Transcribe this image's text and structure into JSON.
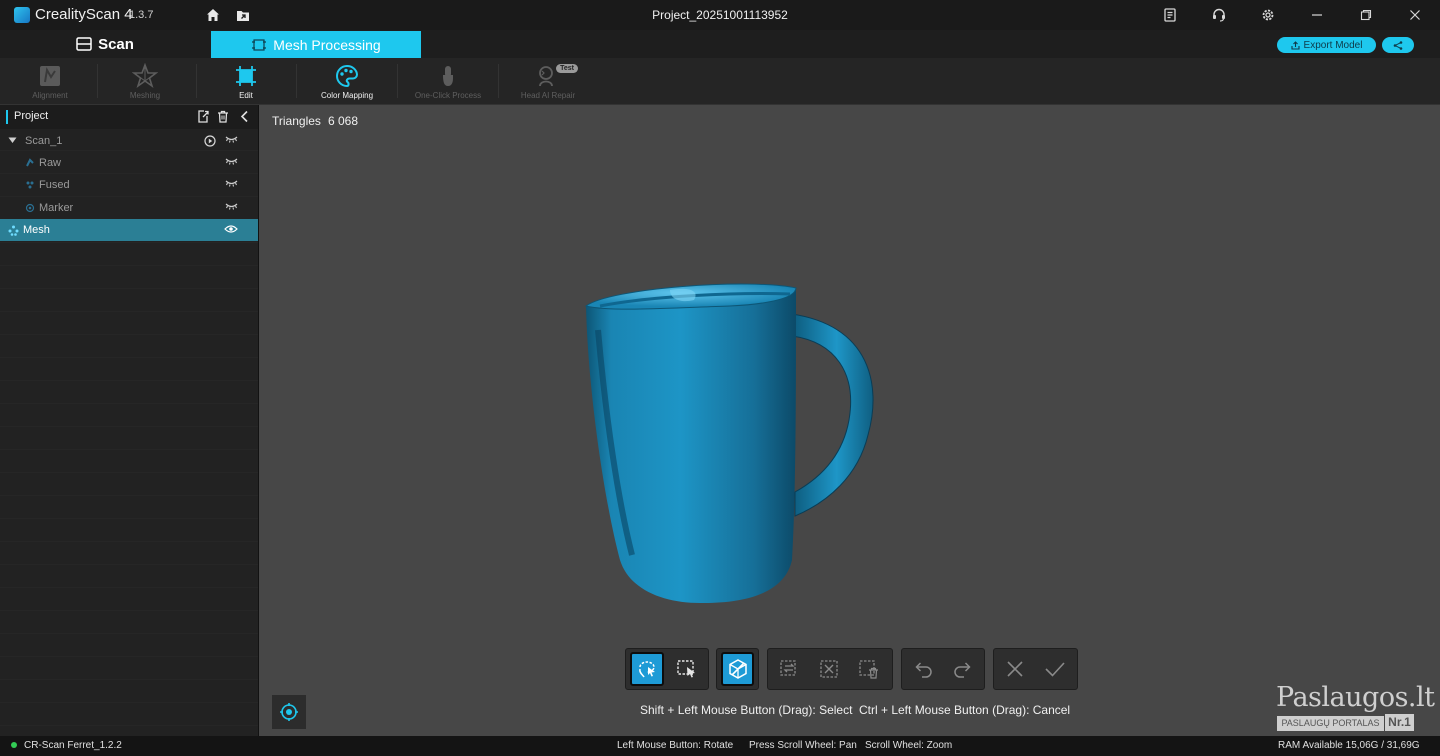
{
  "app": {
    "name": "CrealityScan 4",
    "version": "1.3.7",
    "project_title": "Project_20251001113952"
  },
  "titlebar": {
    "icons": [
      "home-icon",
      "folder-icon",
      "notes-icon",
      "support-headset-icon",
      "gear-icon",
      "minimize-icon",
      "restore-icon",
      "close-icon"
    ]
  },
  "modes": {
    "scan_label": "Scan",
    "mesh_label": "Mesh Processing",
    "active": "Mesh Processing"
  },
  "actions": {
    "export_label": "Export Model",
    "share_icon": "share-icon"
  },
  "toolbar": {
    "items": [
      {
        "label": "Alignment",
        "enabled": false
      },
      {
        "label": "Meshing",
        "enabled": false
      },
      {
        "label": "Edit",
        "enabled": true,
        "active": true
      },
      {
        "label": "Color Mapping",
        "enabled": true
      },
      {
        "label": "One-Click Process",
        "enabled": false
      },
      {
        "label": "Head AI Repair",
        "enabled": false,
        "badge": "Test"
      }
    ]
  },
  "project_panel": {
    "title": "Project",
    "tree": [
      {
        "label": "Scan_1",
        "level": 0,
        "expanded": true,
        "visible": false
      },
      {
        "label": "Raw",
        "level": 1,
        "visible": false
      },
      {
        "label": "Fused",
        "level": 1,
        "visible": false
      },
      {
        "label": "Marker",
        "level": 1,
        "visible": false
      },
      {
        "label": "Mesh",
        "level": 0,
        "selected": true,
        "visible": true
      }
    ]
  },
  "viewport": {
    "triangles_label": "Triangles",
    "triangles_value": "6 068",
    "model_color": "#1c87b4",
    "background_color": "#474747"
  },
  "hints": {
    "select": "Shift + Left Mouse Button (Drag): Select",
    "cancel": "Ctrl + Left Mouse Button (Drag): Cancel"
  },
  "status": {
    "device": "CR-Scan Ferret_1.2.2",
    "rotate": "Left Mouse Button: Rotate",
    "pan": "Press Scroll Wheel: Pan",
    "zoom": "Scroll Wheel: Zoom",
    "ram": "RAM Available 15,06G / 31,69G"
  },
  "watermark": {
    "brand": "Paslaugos.lt",
    "sub": "PASLAUGŲ PORTALAS",
    "nr": "Nr.1"
  },
  "colors": {
    "accent": "#1ec8ee",
    "selected_row": "#2b7f95",
    "active_tool": "#1e9bd6"
  }
}
